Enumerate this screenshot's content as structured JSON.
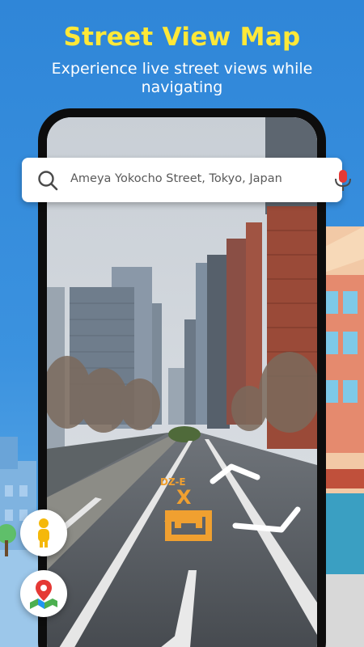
{
  "header": {
    "title": "Street View Map",
    "subtitle": "Experience live street views while navigating"
  },
  "search": {
    "value": "Ameya Yokocho Street, Tokyo, Japan",
    "search_icon": "search-icon",
    "mic_icon": "microphone-icon"
  },
  "road_markings": {
    "code_text": "DZ-E",
    "letter_text": "X"
  },
  "buttons": {
    "street_view_icon": "pegman-person-icon",
    "map_icon": "map-location-pin-icon"
  },
  "colors": {
    "background": "#2f86d8",
    "title": "#ffe838",
    "marking_orange": "#f0a030",
    "mic_red": "#e53935",
    "pin_red": "#e53935",
    "pegman_yellow": "#f5b80a"
  }
}
